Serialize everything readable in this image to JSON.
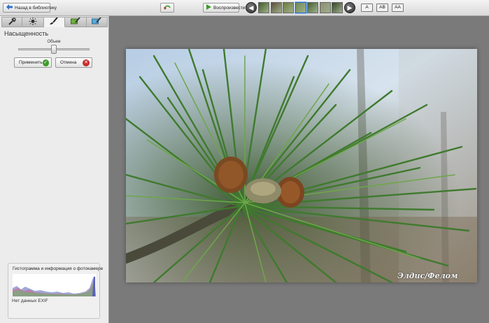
{
  "toolbar": {
    "back_label": "Назад в библиотеку",
    "play_label": "Воспроизвести",
    "text_size_buttons": [
      "A",
      "AB",
      "AA"
    ],
    "thumbnails": [
      {
        "name": "thumb-1",
        "color": "#415a2c"
      },
      {
        "name": "thumb-2",
        "color": "#5b4d3d"
      },
      {
        "name": "thumb-3",
        "color": "#6b7a3c"
      },
      {
        "name": "thumb-4",
        "color": "#708a58"
      },
      {
        "name": "thumb-5",
        "color": "#465f35"
      },
      {
        "name": "thumb-6",
        "color": "#8c8c76"
      },
      {
        "name": "thumb-7",
        "color": "#33432a"
      }
    ],
    "selected_thumbnail": 3
  },
  "sidebar": {
    "tabs": [
      "wrench-icon",
      "sun-icon",
      "brush-icon",
      "tag-edit-icon",
      "frame-edit-icon"
    ],
    "active_tab": 2,
    "section_title": "Насыщенность",
    "slider": {
      "label": "Объем",
      "value_fraction": 0.5
    },
    "apply_label": "Применить",
    "cancel_label": "Отмена"
  },
  "histogram": {
    "title": "Гистограмма и информация о фотокамере",
    "exif_label": "Нет данных EXIF"
  },
  "photo": {
    "watermark": "Элдис/Фелом",
    "description_icon": "pine-branch-photo"
  },
  "colors": {
    "accent_blue": "#2f6fc6",
    "apply_green": "#3d9b2b",
    "cancel_red": "#c62b2b",
    "background": "#7a7a7a"
  }
}
